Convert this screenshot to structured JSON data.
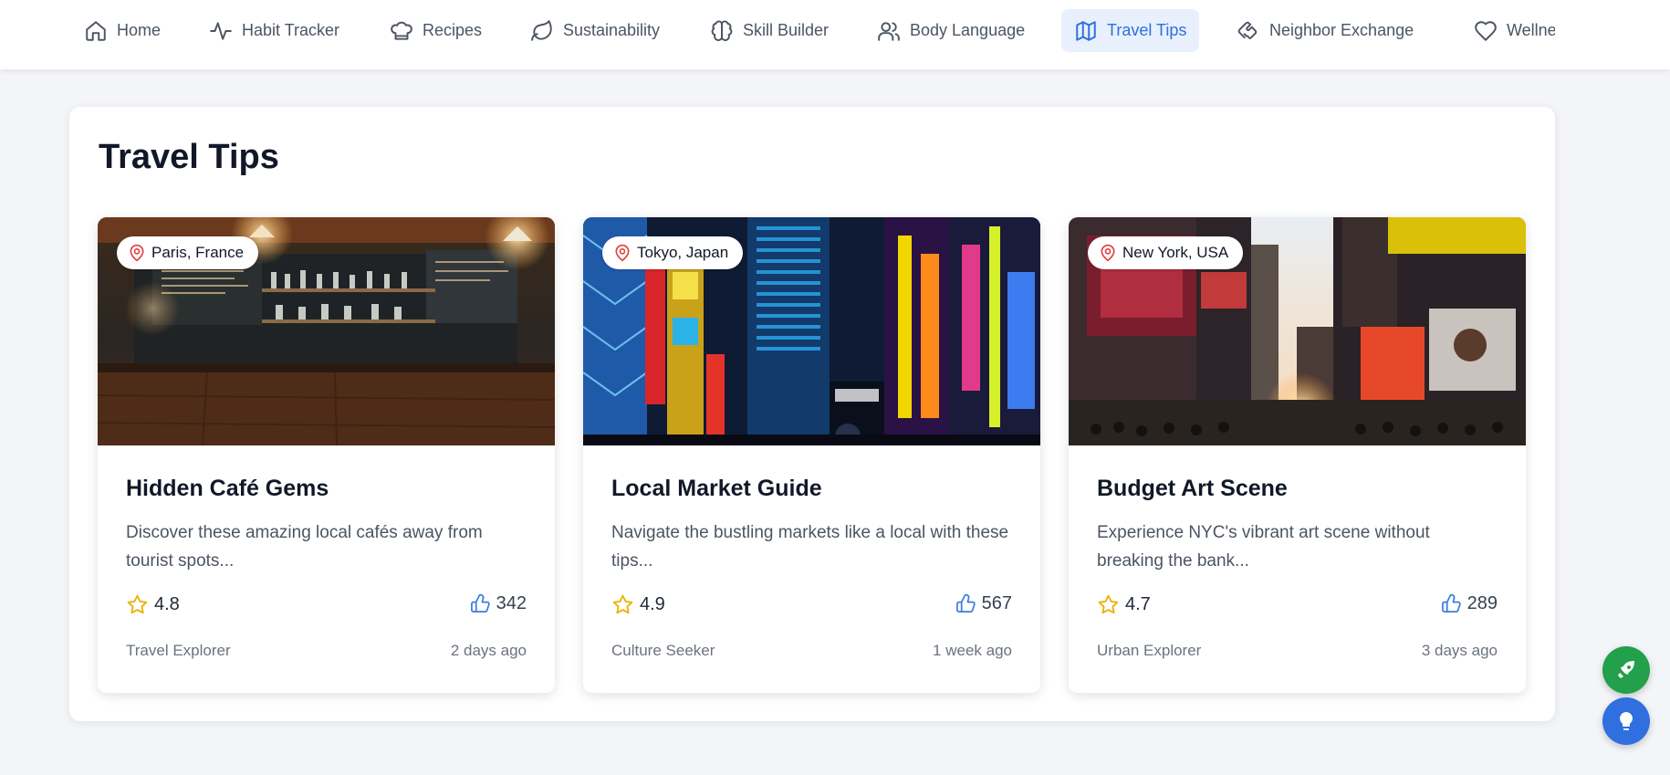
{
  "nav": {
    "items": [
      {
        "label": "Home",
        "icon": "home-icon"
      },
      {
        "label": "Habit Tracker",
        "icon": "activity-icon"
      },
      {
        "label": "Recipes",
        "icon": "chef-hat-icon"
      },
      {
        "label": "Sustainability",
        "icon": "leaf-icon"
      },
      {
        "label": "Skill Builder",
        "icon": "brain-icon"
      },
      {
        "label": "Body Language",
        "icon": "users-icon"
      },
      {
        "label": "Travel Tips",
        "icon": "map-icon",
        "active": true
      },
      {
        "label": "Neighbor Exchange",
        "icon": "handshake-icon"
      },
      {
        "label": "Wellness",
        "icon": "heart-icon"
      }
    ],
    "active_color": "#2f6fe0"
  },
  "page": {
    "title": "Travel Tips"
  },
  "cards": [
    {
      "location": "Paris, France",
      "title": "Hidden Café Gems",
      "description": "Discover these amazing local cafés away from tourist spots...",
      "rating": "4.8",
      "likes": "342",
      "author": "Travel Explorer",
      "time": "2 days ago"
    },
    {
      "location": "Tokyo, Japan",
      "title": "Local Market Guide",
      "description": "Navigate the bustling markets like a local with these tips...",
      "rating": "4.9",
      "likes": "567",
      "author": "Culture Seeker",
      "time": "1 week ago"
    },
    {
      "location": "New York, USA",
      "title": "Budget Art Scene",
      "description": "Experience NYC's vibrant art scene without breaking the bank...",
      "rating": "4.7",
      "likes": "289",
      "author": "Urban Explorer",
      "time": "3 days ago"
    }
  ],
  "fabs": {
    "rocket_color": "#22a04b",
    "bulb_color": "#2f6fe0"
  }
}
